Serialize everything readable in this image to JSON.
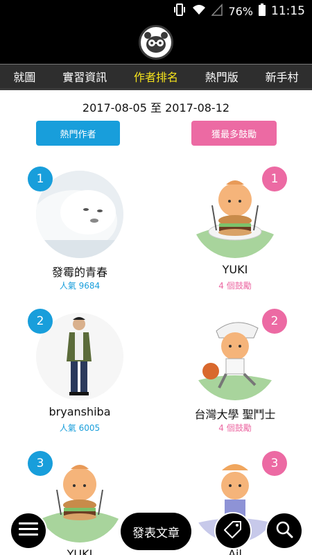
{
  "status_bar": {
    "battery": "76%",
    "time": "11:15"
  },
  "tabs": [
    {
      "label": "就圖",
      "active": false
    },
    {
      "label": "實習資訊",
      "active": false
    },
    {
      "label": "作者排名",
      "active": true
    },
    {
      "label": "熱門版",
      "active": false
    },
    {
      "label": "新手村",
      "active": false
    }
  ],
  "date_range": "2017-08-05 至 2017-08-12",
  "filters": {
    "popular": "熱門作者",
    "most_encouraged": "獲最多鼓勵"
  },
  "popular_authors": [
    {
      "rank": "1",
      "name": "發霉的青春",
      "stat": "人氣 9684"
    },
    {
      "rank": "2",
      "name": "bryanshiba",
      "stat": "人氣 6005"
    },
    {
      "rank": "3",
      "name": "YUKI",
      "stat": ""
    }
  ],
  "encouraged_authors": [
    {
      "rank": "1",
      "name": "YUKI",
      "stat": "4 個鼓勵"
    },
    {
      "rank": "2",
      "name": "台灣大學 聖鬥士",
      "stat": "4 個鼓勵"
    },
    {
      "rank": "3",
      "name": "Ail",
      "stat": ""
    }
  ],
  "actions": {
    "post": "發表文章"
  },
  "colors": {
    "accent_blue": "#189edb",
    "accent_pink": "#ec6aa3",
    "active_tab": "#f5e31c"
  }
}
